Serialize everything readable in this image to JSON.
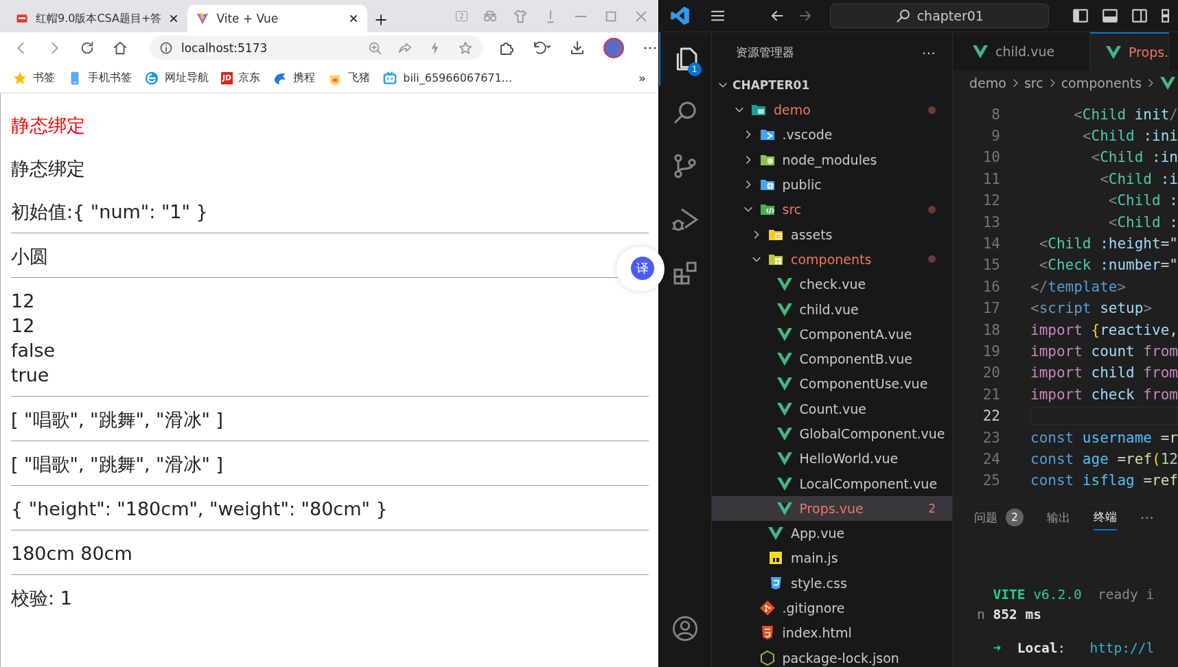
{
  "browser": {
    "tabs": [
      {
        "title": "红帽9.0版本CSA题目+答",
        "selected": false
      },
      {
        "title": "Vite + Vue",
        "selected": true
      }
    ],
    "tab_counter": "2",
    "address": {
      "url": "localhost:5173"
    },
    "bookmarks": [
      {
        "label": "书签"
      },
      {
        "label": "手机书签"
      },
      {
        "label": "网址导航"
      },
      {
        "label": "京东",
        "badge_text": "JD"
      },
      {
        "label": "携程"
      },
      {
        "label": "飞猪"
      },
      {
        "label": "bili_65966067671..."
      }
    ],
    "bookmarks_more": "»",
    "page": {
      "sections": [
        {
          "kind": "paragraphs",
          "lines": [
            {
              "text": "静态绑定",
              "kind": "red"
            },
            {
              "text": "静态绑定",
              "kind": "plain"
            },
            {
              "text": "初始值:{ \"num\": \"1\" }",
              "kind": "plain"
            }
          ]
        },
        {
          "kind": "lines",
          "lines": [
            {
              "text": "小圆",
              "kind": "plain"
            }
          ]
        },
        {
          "kind": "lines",
          "lines": [
            {
              "text": "12",
              "kind": "plain"
            },
            {
              "text": "12",
              "kind": "plain"
            },
            {
              "text": "false",
              "kind": "plain"
            },
            {
              "text": "true",
              "kind": "plain"
            }
          ]
        },
        {
          "kind": "lines",
          "lines": [
            {
              "text": "[ \"唱歌\", \"跳舞\", \"滑冰\" ]",
              "kind": "plain"
            }
          ]
        },
        {
          "kind": "lines",
          "lines": [
            {
              "text": "[ \"唱歌\", \"跳舞\", \"滑冰\" ]",
              "kind": "plain"
            }
          ]
        },
        {
          "kind": "lines",
          "lines": [
            {
              "text": "{ \"height\": \"180cm\", \"weight\": \"80cm\" }",
              "kind": "plain"
            }
          ]
        },
        {
          "kind": "lines",
          "lines": [
            {
              "text": "180cm 80cm",
              "kind": "plain"
            }
          ]
        },
        {
          "kind": "lines",
          "lines": [
            {
              "text": "校验: 1",
              "kind": "plain"
            }
          ]
        }
      ]
    },
    "translate_button": "译"
  },
  "editor_app": {
    "search": "chapter01",
    "activity_bar": [
      {
        "selected": true,
        "badge": "1"
      },
      {
        "selected": false
      },
      {
        "selected": false
      },
      {
        "selected": false
      },
      {
        "selected": false
      }
    ],
    "explorer": {
      "title": "资源管理器",
      "more": "⋯",
      "root": {
        "label": "CHAPTER01",
        "expanded": true
      },
      "tree": [
        {
          "label": "demo",
          "kind": "folder",
          "expanded": true,
          "modified": true,
          "selected": false,
          "children": [
            {
              "label": ".vscode",
              "kind": "folder",
              "expanded": false,
              "modified": false,
              "selected": false
            },
            {
              "label": "node_modules",
              "kind": "folder",
              "expanded": false,
              "modified": false,
              "selected": false
            },
            {
              "label": "public",
              "kind": "folder",
              "expanded": false,
              "modified": false,
              "selected": false
            },
            {
              "label": "src",
              "kind": "folder",
              "expanded": true,
              "modified": true,
              "selected": false,
              "children": [
                {
                  "label": "assets",
                  "kind": "folder",
                  "expanded": false,
                  "modified": false,
                  "selected": false
                },
                {
                  "label": "components",
                  "kind": "folder",
                  "expanded": true,
                  "modified": true,
                  "selected": false,
                  "children": [
                    {
                      "label": "check.vue",
                      "kind": "vue",
                      "modified": false,
                      "selected": false
                    },
                    {
                      "label": "child.vue",
                      "kind": "vue",
                      "modified": false,
                      "selected": false
                    },
                    {
                      "label": "ComponentA.vue",
                      "kind": "vue",
                      "modified": false,
                      "selected": false
                    },
                    {
                      "label": "ComponentB.vue",
                      "kind": "vue",
                      "modified": false,
                      "selected": false
                    },
                    {
                      "label": "ComponentUse.vue",
                      "kind": "vue",
                      "modified": false,
                      "selected": false
                    },
                    {
                      "label": "Count.vue",
                      "kind": "vue",
                      "modified": false,
                      "selected": false
                    },
                    {
                      "label": "GlobalComponent.vue",
                      "kind": "vue",
                      "modified": false,
                      "selected": false
                    },
                    {
                      "label": "HelloWorld.vue",
                      "kind": "vue",
                      "modified": false,
                      "selected": false
                    },
                    {
                      "label": "LocalComponent.vue",
                      "kind": "vue",
                      "modified": false,
                      "selected": false
                    },
                    {
                      "label": "Props.vue",
                      "kind": "vue",
                      "modified": true,
                      "selected": true,
                      "problems": "2"
                    }
                  ]
                },
                {
                  "label": "App.vue",
                  "kind": "vue",
                  "modified": false,
                  "selected": false
                },
                {
                  "label": "main.js",
                  "kind": "js",
                  "modified": false,
                  "selected": false
                },
                {
                  "label": "style.css",
                  "kind": "css",
                  "modified": false,
                  "selected": false
                }
              ]
            },
            {
              "label": ".gitignore",
              "kind": "git",
              "modified": false,
              "selected": false
            },
            {
              "label": "index.html",
              "kind": "html",
              "modified": false,
              "selected": false
            },
            {
              "label": "package-lock.json",
              "kind": "json",
              "modified": false,
              "selected": false
            }
          ]
        }
      ]
    },
    "editor_tabs": [
      {
        "label": "child.vue",
        "selected": false,
        "modified": false
      },
      {
        "label": "Props.",
        "selected": true,
        "modified": true
      }
    ],
    "breadcrumb": [
      "demo",
      "src",
      "components"
    ],
    "code": [
      {
        "number": "8",
        "current": false,
        "tokens": [
          {
            "kind": "punct",
            "text": "     <"
          },
          {
            "kind": "tag",
            "text": "Child"
          },
          {
            "kind": "attr",
            "text": " init"
          },
          {
            "kind": "punct",
            "text": "/"
          }
        ]
      },
      {
        "number": "9",
        "current": false,
        "tokens": [
          {
            "kind": "punct",
            "text": "      <"
          },
          {
            "kind": "tag",
            "text": "Child"
          },
          {
            "kind": "attr",
            "text": " :ini"
          }
        ]
      },
      {
        "number": "10",
        "current": false,
        "tokens": [
          {
            "kind": "punct",
            "text": "       <"
          },
          {
            "kind": "tag",
            "text": "Child"
          },
          {
            "kind": "attr",
            "text": " :in"
          }
        ]
      },
      {
        "number": "11",
        "current": false,
        "tokens": [
          {
            "kind": "punct",
            "text": "        <"
          },
          {
            "kind": "tag",
            "text": "Child"
          },
          {
            "kind": "attr",
            "text": " :i"
          }
        ]
      },
      {
        "number": "12",
        "current": false,
        "tokens": [
          {
            "kind": "punct",
            "text": "         <"
          },
          {
            "kind": "tag",
            "text": "Child"
          },
          {
            "kind": "attr",
            "text": " :"
          }
        ]
      },
      {
        "number": "13",
        "current": false,
        "tokens": [
          {
            "kind": "punct",
            "text": "         <"
          },
          {
            "kind": "tag",
            "text": "Child"
          },
          {
            "kind": "attr",
            "text": " :"
          }
        ]
      },
      {
        "number": "14",
        "current": false,
        "tokens": [
          {
            "kind": "punct",
            "text": " <"
          },
          {
            "kind": "tag",
            "text": "Child"
          },
          {
            "kind": "attr",
            "text": " :height"
          },
          {
            "kind": "plain",
            "text": "=\""
          }
        ]
      },
      {
        "number": "15",
        "current": false,
        "tokens": [
          {
            "kind": "punct",
            "text": " <"
          },
          {
            "kind": "tag",
            "text": "Check"
          },
          {
            "kind": "attr",
            "text": " :number"
          },
          {
            "kind": "plain",
            "text": "=\""
          }
        ]
      },
      {
        "number": "16",
        "current": false,
        "tokens": [
          {
            "kind": "punct",
            "text": "</"
          },
          {
            "kind": "tagb",
            "text": "template"
          },
          {
            "kind": "punct",
            "text": ">"
          }
        ]
      },
      {
        "number": "17",
        "current": false,
        "tokens": [
          {
            "kind": "punct",
            "text": "<"
          },
          {
            "kind": "tagb",
            "text": "script"
          },
          {
            "kind": "attr",
            "text": " setup"
          },
          {
            "kind": "punct",
            "text": ">"
          }
        ]
      },
      {
        "number": "18",
        "current": false,
        "tokens": [
          {
            "kind": "keyword",
            "text": "import"
          },
          {
            "kind": "bracket",
            "text": " {"
          },
          {
            "kind": "var",
            "text": "reactive"
          },
          {
            "kind": "plain",
            "text": ","
          }
        ]
      },
      {
        "number": "19",
        "current": false,
        "tokens": [
          {
            "kind": "keyword",
            "text": "import"
          },
          {
            "kind": "var",
            "text": " count"
          },
          {
            "kind": "keyword",
            "text": " from"
          }
        ]
      },
      {
        "number": "20",
        "current": false,
        "tokens": [
          {
            "kind": "keyword",
            "text": "import"
          },
          {
            "kind": "var",
            "text": " child"
          },
          {
            "kind": "keyword",
            "text": " from"
          }
        ]
      },
      {
        "number": "21",
        "current": false,
        "tokens": [
          {
            "kind": "keyword",
            "text": "import"
          },
          {
            "kind": "var",
            "text": " check"
          },
          {
            "kind": "keyword",
            "text": " from"
          }
        ]
      },
      {
        "number": "22",
        "current": true
      },
      {
        "number": "23",
        "current": false,
        "tokens": [
          {
            "kind": "storage",
            "text": "const"
          },
          {
            "kind": "const",
            "text": " username"
          },
          {
            "kind": "plain",
            "text": " ="
          },
          {
            "kind": "func",
            "text": "r"
          }
        ]
      },
      {
        "number": "24",
        "current": false,
        "tokens": [
          {
            "kind": "storage",
            "text": "const"
          },
          {
            "kind": "const",
            "text": " age"
          },
          {
            "kind": "plain",
            "text": " ="
          },
          {
            "kind": "func",
            "text": "ref"
          },
          {
            "kind": "bracket",
            "text": "("
          },
          {
            "kind": "number",
            "text": "12"
          }
        ]
      },
      {
        "number": "25",
        "current": false,
        "tokens": [
          {
            "kind": "storage",
            "text": "const"
          },
          {
            "kind": "const",
            "text": " isflag"
          },
          {
            "kind": "plain",
            "text": " ="
          },
          {
            "kind": "func",
            "text": "ref"
          }
        ]
      }
    ],
    "panel": {
      "tabs": [
        {
          "label": "问题",
          "badge": "2",
          "selected": false
        },
        {
          "label": "输出",
          "selected": false
        },
        {
          "label": "终端",
          "selected": true
        }
      ],
      "more": "⋯",
      "terminal": [
        {
          "lines": [
            {
              "tokens": [
                {
                  "kind": "brand",
                  "text": "  VITE"
                },
                {
                  "kind": "green",
                  "text": " v6.2.0"
                },
                {
                  "kind": "dim",
                  "text": "  ready i"
                }
              ]
            },
            {
              "tokens": [
                {
                  "kind": "dim",
                  "text": "n "
                },
                {
                  "kind": "bold",
                  "text": "852 ms"
                }
              ]
            }
          ]
        },
        {
          "lines": [
            {
              "tokens": [
                {
                  "kind": "green",
                  "text": "  ➜"
                },
                {
                  "kind": "bold",
                  "text": "  Local"
                },
                {
                  "kind": "plain",
                  "text": ":   "
                },
                {
                  "kind": "link",
                  "text": "http://l"
                }
              ]
            }
          ]
        }
      ]
    }
  }
}
